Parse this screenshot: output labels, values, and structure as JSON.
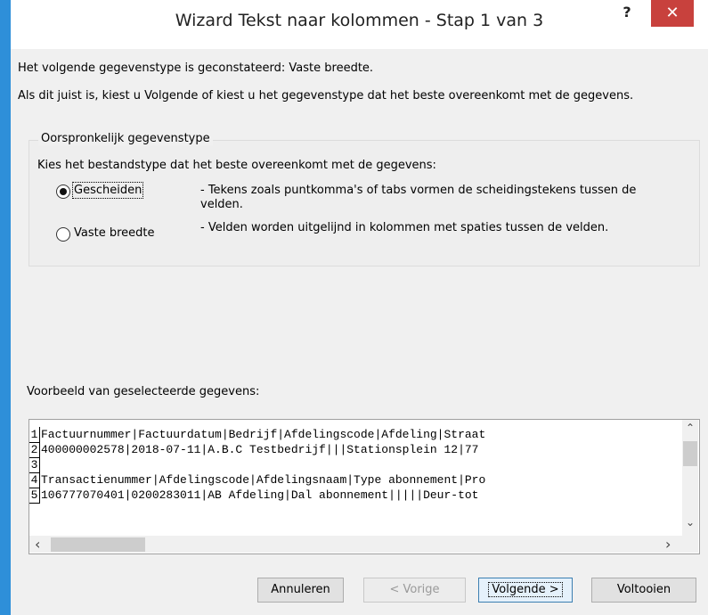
{
  "window": {
    "title": "Wizard Tekst naar kolommen - Stap 1 van 3"
  },
  "titlebar": {
    "help_label": "?",
    "close_label": "✕"
  },
  "intro": {
    "detected": "Het volgende gegevenstype is geconstateerd: Vaste breedte.",
    "instruction": "Als dit juist is, kiest u Volgende of kiest u het gegevenstype dat het beste overeenkomt met de gegevens."
  },
  "original_type": {
    "legend": "Oorspronkelijk gegevenstype",
    "prompt": "Kies het bestandstype dat het beste overeenkomt met de gegevens:",
    "options": [
      {
        "label": "Gescheiden",
        "checked": true,
        "description": "- Tekens zoals puntkomma's of tabs vormen de scheidingstekens tussen de velden."
      },
      {
        "label": "Vaste breedte",
        "checked": false,
        "description": "- Velden worden uitgelijnd in kolommen met spaties tussen de velden."
      }
    ]
  },
  "preview": {
    "label": "Voorbeeld van geselecteerde gegevens:",
    "rows": [
      {
        "num": "1",
        "text": "Factuurnummer|Factuurdatum|Bedrijf|Afdelingscode|Afdeling|Straat"
      },
      {
        "num": "2",
        "text": "400000002578|2018-07-11|A.B.C Testbedrijf|||Stationsplein 12|77"
      },
      {
        "num": "3",
        "text": ""
      },
      {
        "num": "4",
        "text": "Transactienummer|Afdelingscode|Afdelingsnaam|Type abonnement|Pro"
      },
      {
        "num": "5",
        "text": "106777070401|0200283011|AB Afdeling|Dal abonnement|||||Deur-tot"
      }
    ]
  },
  "buttons": {
    "cancel": "Annuleren",
    "back": "< Vorige",
    "next": "Volgende >",
    "finish": "Voltooien"
  },
  "colors": {
    "close_bg": "#c8413d",
    "accent_edge": "#2e8fd9"
  }
}
